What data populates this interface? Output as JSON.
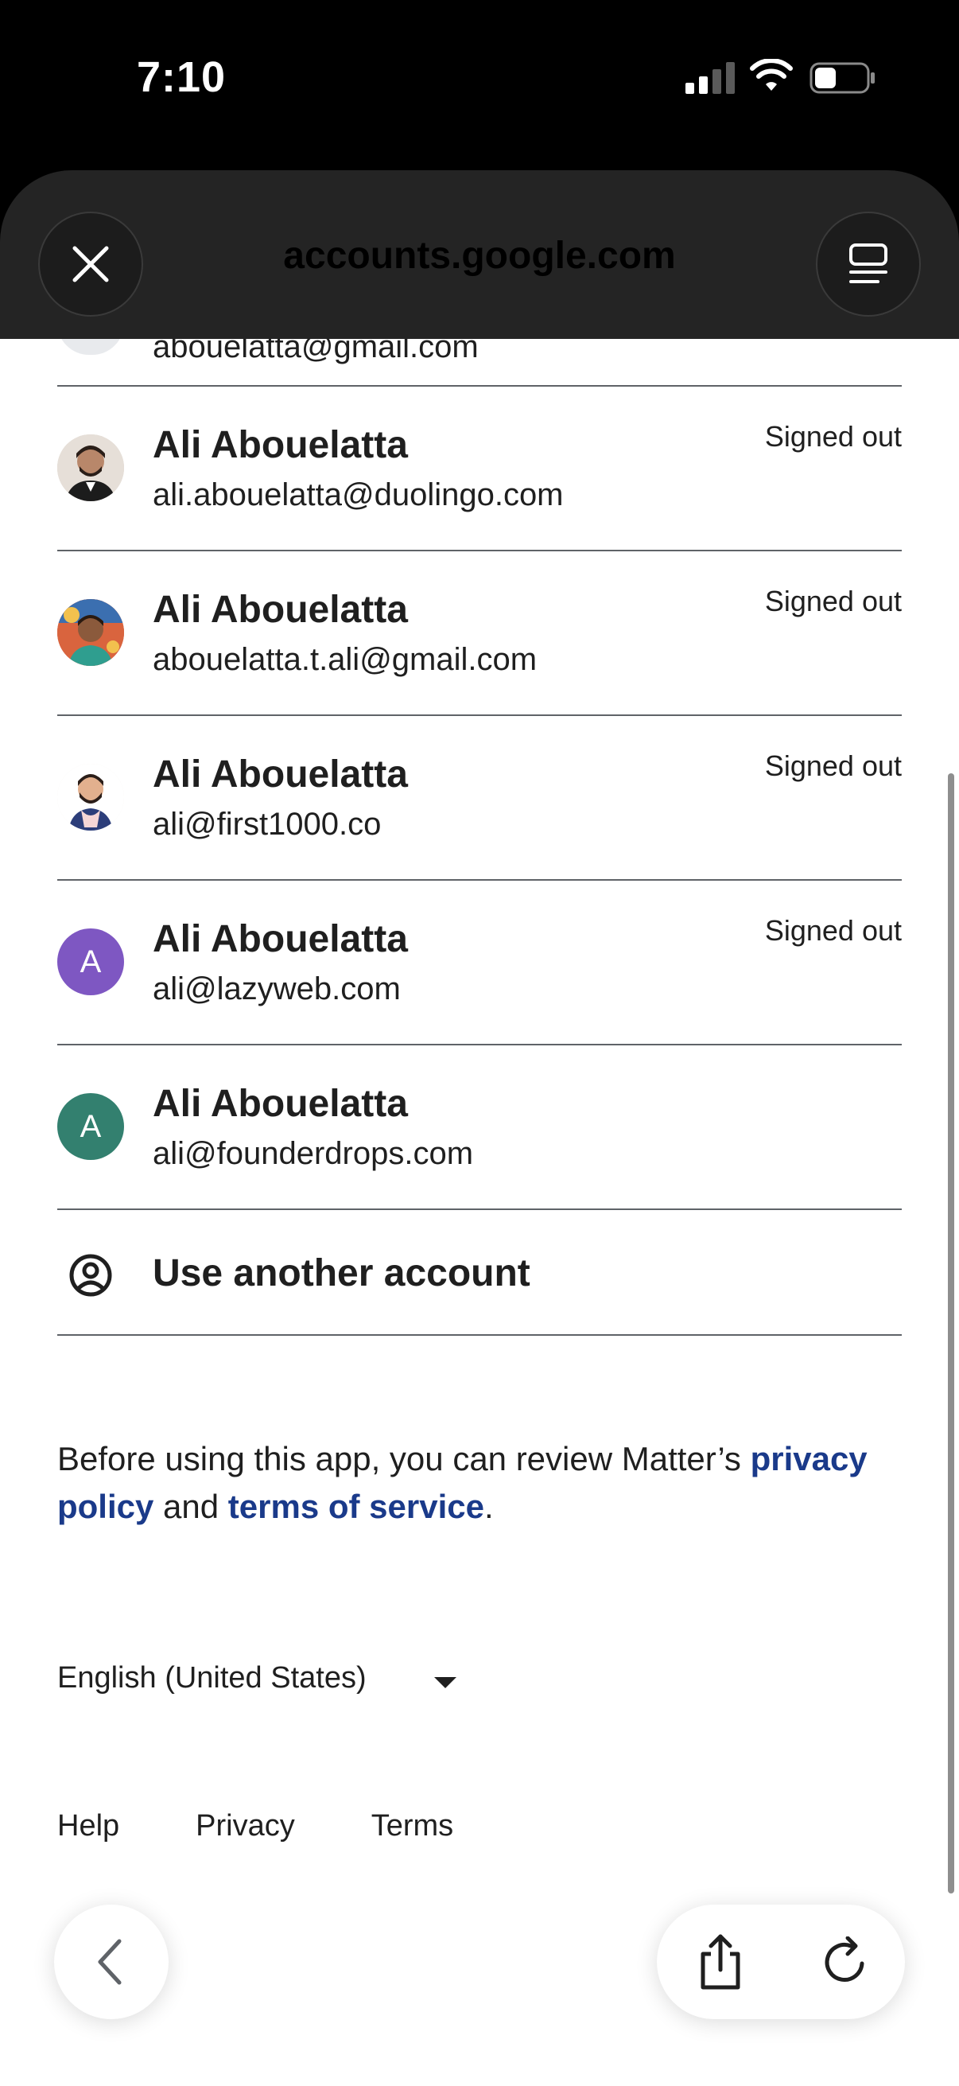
{
  "status_bar": {
    "time": "7:10"
  },
  "browser": {
    "url_title": "accounts.google.com",
    "partial_email": "abouelatta@gmail.com",
    "icons": {
      "close": "close-icon",
      "reader": "reader-mode-icon",
      "back": "chevron-left-icon",
      "share": "share-icon",
      "reload": "reload-icon"
    }
  },
  "accounts": [
    {
      "name": "Ali Abouelatta",
      "email": "ali.abouelatta@duolingo.com",
      "status": "Signed out",
      "avatar": "photo",
      "avatar_color": "#d9cfc4"
    },
    {
      "name": "Ali Abouelatta",
      "email": "abouelatta.t.ali@gmail.com",
      "status": "Signed out",
      "avatar": "illustration",
      "avatar_color": "#c8553d"
    },
    {
      "name": "Ali Abouelatta",
      "email": "ali@first1000.co",
      "status": "Signed out",
      "avatar": "cartoon",
      "avatar_color": "#f3ece6"
    },
    {
      "name": "Ali Abouelatta",
      "email": "ali@lazyweb.com",
      "status": "Signed out",
      "avatar_letter": "A",
      "avatar_color": "#7e57c2"
    },
    {
      "name": "Ali Abouelatta",
      "email": "ali@founderdrops.com",
      "status": "",
      "avatar_letter": "A",
      "avatar_color": "#33806f"
    }
  ],
  "use_another": {
    "label": "Use another account",
    "icon": "account-circle-icon"
  },
  "privacy": {
    "prefix": "Before using this app, you can review Matter’s ",
    "privacy_link": "privacy policy",
    "middle": " and ",
    "terms_link": "terms of service",
    "suffix": "."
  },
  "language": {
    "selected": "English (United States)"
  },
  "footer": {
    "help": "Help",
    "privacy": "Privacy",
    "terms": "Terms"
  },
  "colors": {
    "link": "#1a3a8a",
    "divider": "#5f6368",
    "header": "#242424"
  }
}
